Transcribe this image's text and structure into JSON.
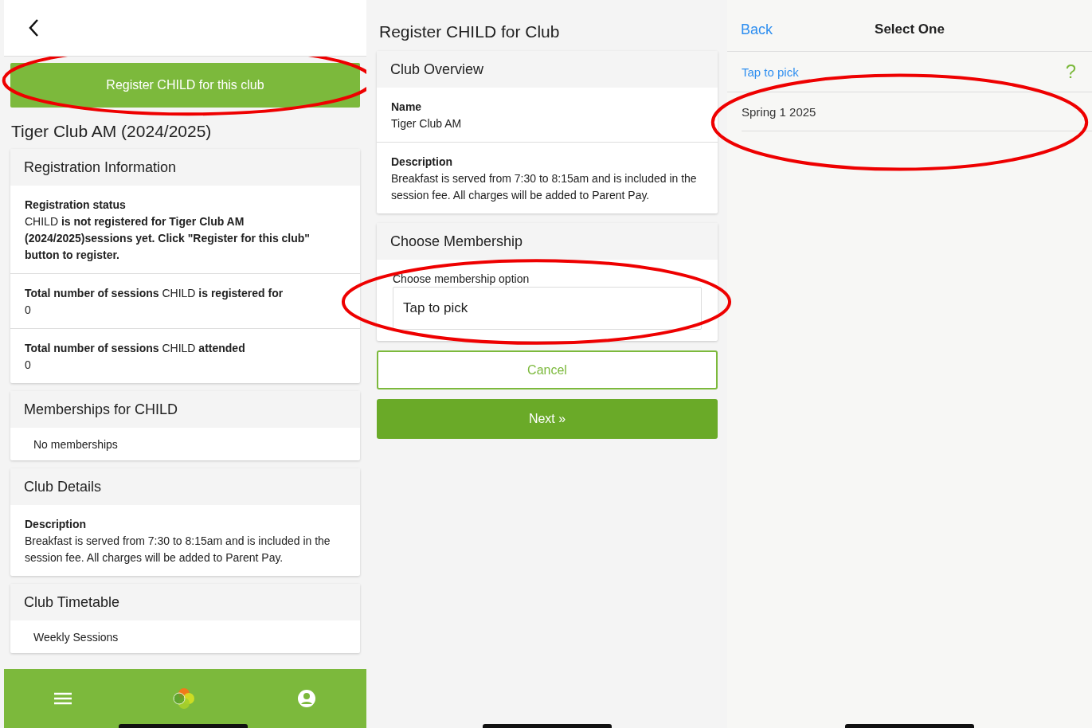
{
  "club_page": {
    "register_button": {
      "label": "Register CHILD for this club",
      "highlighted": true
    },
    "club_title": "Tiger Club AM (2024/2025)",
    "sections": [
      {
        "title": "Registration Information",
        "rows": [
          {
            "label": "**Registration status**",
            "value": "CHILD **is not registered for Tiger Club AM (2024/2025)sessions yet. Click \"Register for this club\" button to register.**"
          },
          {
            "label": "**Total number of sessions** CHILD **is registered for**",
            "value": "0"
          },
          {
            "label": "**Total number of sessions** CHILD **attended**",
            "value": "0"
          }
        ]
      },
      {
        "title": "Memberships for CHILD",
        "note": "No memberships"
      },
      {
        "title": "Club Details",
        "rows": [
          {
            "label": "**Description**",
            "value": "Breakfast is served from 7:30 to 8:15am and is included in the session fee. All charges will be added to Parent Pay."
          }
        ]
      },
      {
        "title": "Club Timetable",
        "note": "Weekly Sessions"
      }
    ]
  },
  "register_page": {
    "title": "Register CHILD for Club",
    "sections": [
      {
        "title": "Club Overview",
        "rows": [
          {
            "label": "**Name**",
            "value": "Tiger Club AM"
          },
          {
            "label": "**Description**",
            "value": "Breakfast is served from 7:30 to 8:15am and is included in the session fee. All charges will be added to Parent Pay."
          }
        ]
      }
    ],
    "membership": {
      "title": "Choose Membership",
      "field_label": "Choose membership option",
      "placeholder": "Tap to pick",
      "highlighted": true
    },
    "cancel_button": "Cancel",
    "next_button": "Next »"
  },
  "picker": {
    "back": "Back",
    "title": "Select One",
    "prompt": "Tap to pick",
    "help": "?",
    "options": [
      {
        "label": "Spring 1 2025"
      }
    ],
    "highlighted": true
  }
}
